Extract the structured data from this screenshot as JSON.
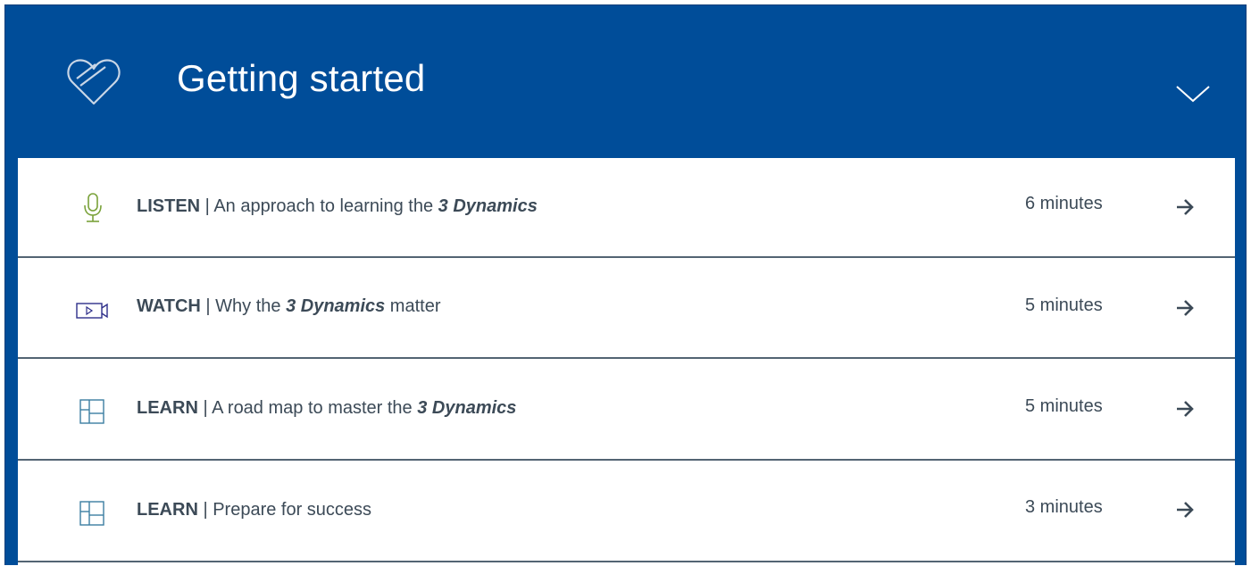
{
  "section": {
    "title": "Getting started",
    "icon": "heart-outline-icon",
    "collapse_icon": "chevron-down-icon"
  },
  "colors": {
    "header_bg": "#004d99",
    "text": "#3c4a57",
    "listen_icon": "#7aa23a",
    "watch_icon": "#2e2f8a",
    "learn_icon": "#3b7ea1",
    "divider": "#536473"
  },
  "items": [
    {
      "kind": "LISTEN",
      "separator": " | ",
      "text_before": "An approach to learning the ",
      "emphasis": "3 Dynamics",
      "text_after": "",
      "duration": "6 minutes",
      "icon": "microphone-icon"
    },
    {
      "kind": "WATCH",
      "separator": " | ",
      "text_before": "Why the ",
      "emphasis": "3 Dynamics",
      "text_after": " matter",
      "duration": "5 minutes",
      "icon": "video-camera-icon"
    },
    {
      "kind": "LEARN",
      "separator": " | ",
      "text_before": "A road map to master the ",
      "emphasis": "3 Dynamics",
      "text_after": "",
      "duration": "5 minutes",
      "icon": "layout-grid-icon"
    },
    {
      "kind": "LEARN",
      "separator": " | ",
      "text_before": "Prepare for success",
      "emphasis": "",
      "text_after": "",
      "duration": "3 minutes",
      "icon": "layout-grid-icon"
    }
  ]
}
